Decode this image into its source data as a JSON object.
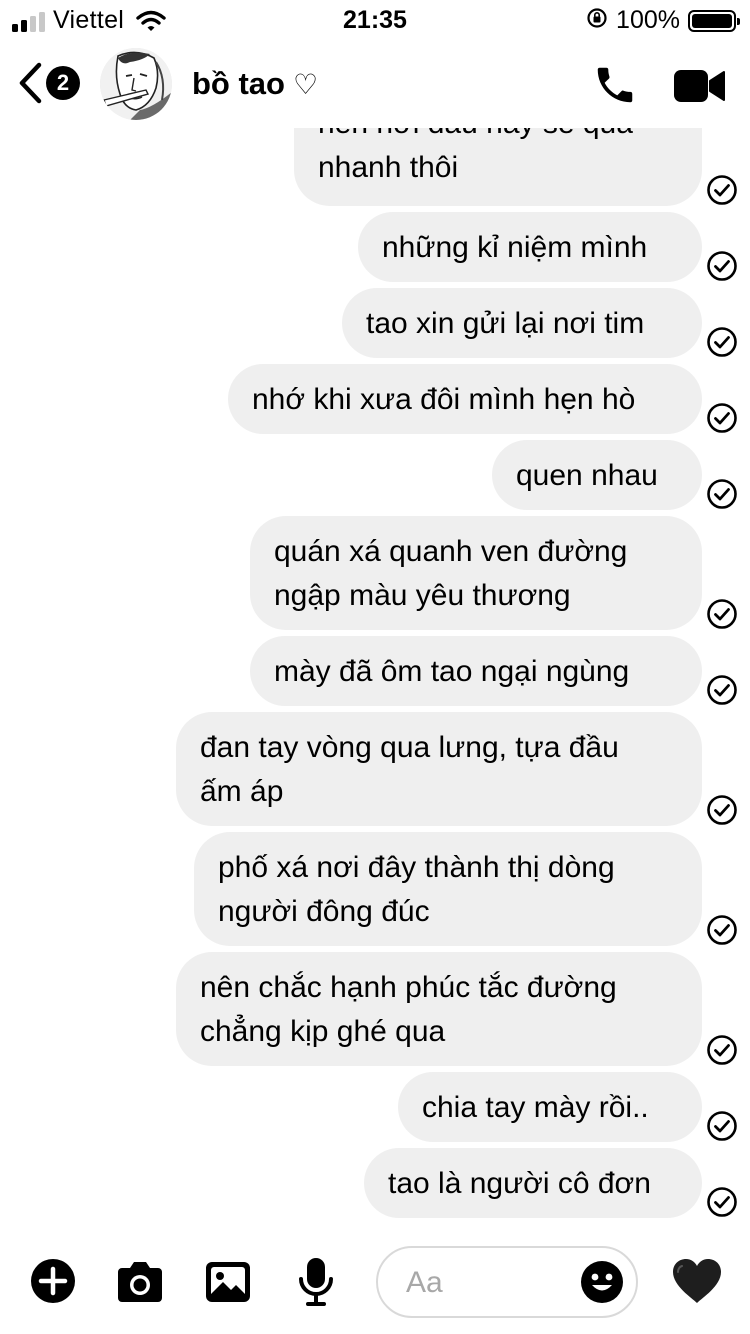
{
  "status_bar": {
    "carrier": "Viettel",
    "time": "21:35",
    "battery_percent": "100%",
    "signal_bars": 2
  },
  "header": {
    "back_badge": "2",
    "contact_name": "bồ tao",
    "name_heart": "♡"
  },
  "messages": [
    {
      "lines": [
        "nên nơi đâu hãy sẽ qua",
        "nhanh thôi"
      ]
    },
    {
      "lines": [
        "những kỉ niệm mình"
      ]
    },
    {
      "lines": [
        "tao xin gửi lại nơi tim"
      ]
    },
    {
      "lines": [
        "nhớ khi xưa đôi mình hẹn hò"
      ]
    },
    {
      "lines": [
        "quen nhau"
      ]
    },
    {
      "lines": [
        "quán xá quanh ven đường",
        "ngập màu yêu thương"
      ]
    },
    {
      "lines": [
        "mày đã ôm tao ngại ngùng"
      ]
    },
    {
      "lines": [
        "đan tay vòng qua lưng, tựa đầu",
        "ấm áp"
      ]
    },
    {
      "lines": [
        "phố xá nơi đây thành thị dòng",
        "người đông đúc"
      ]
    },
    {
      "lines": [
        "nên chắc hạnh phúc tắc đường",
        "chẳng kịp ghé qua"
      ]
    },
    {
      "lines": [
        "chia tay mày rồi.."
      ]
    },
    {
      "lines": [
        "tao là người cô đơn"
      ]
    }
  ],
  "composer": {
    "placeholder": "Aa",
    "value": ""
  },
  "icons": {
    "plus": "plus-circle-icon",
    "camera": "camera-icon",
    "gallery": "image-icon",
    "mic": "microphone-icon",
    "emoji": "smiley-icon",
    "like": "black-heart-icon",
    "call": "phone-icon",
    "video": "video-camera-icon",
    "seen": "check-circle-icon"
  },
  "colors": {
    "bubble": "#efefef",
    "text": "#000000",
    "placeholder": "#a8a8a8"
  }
}
